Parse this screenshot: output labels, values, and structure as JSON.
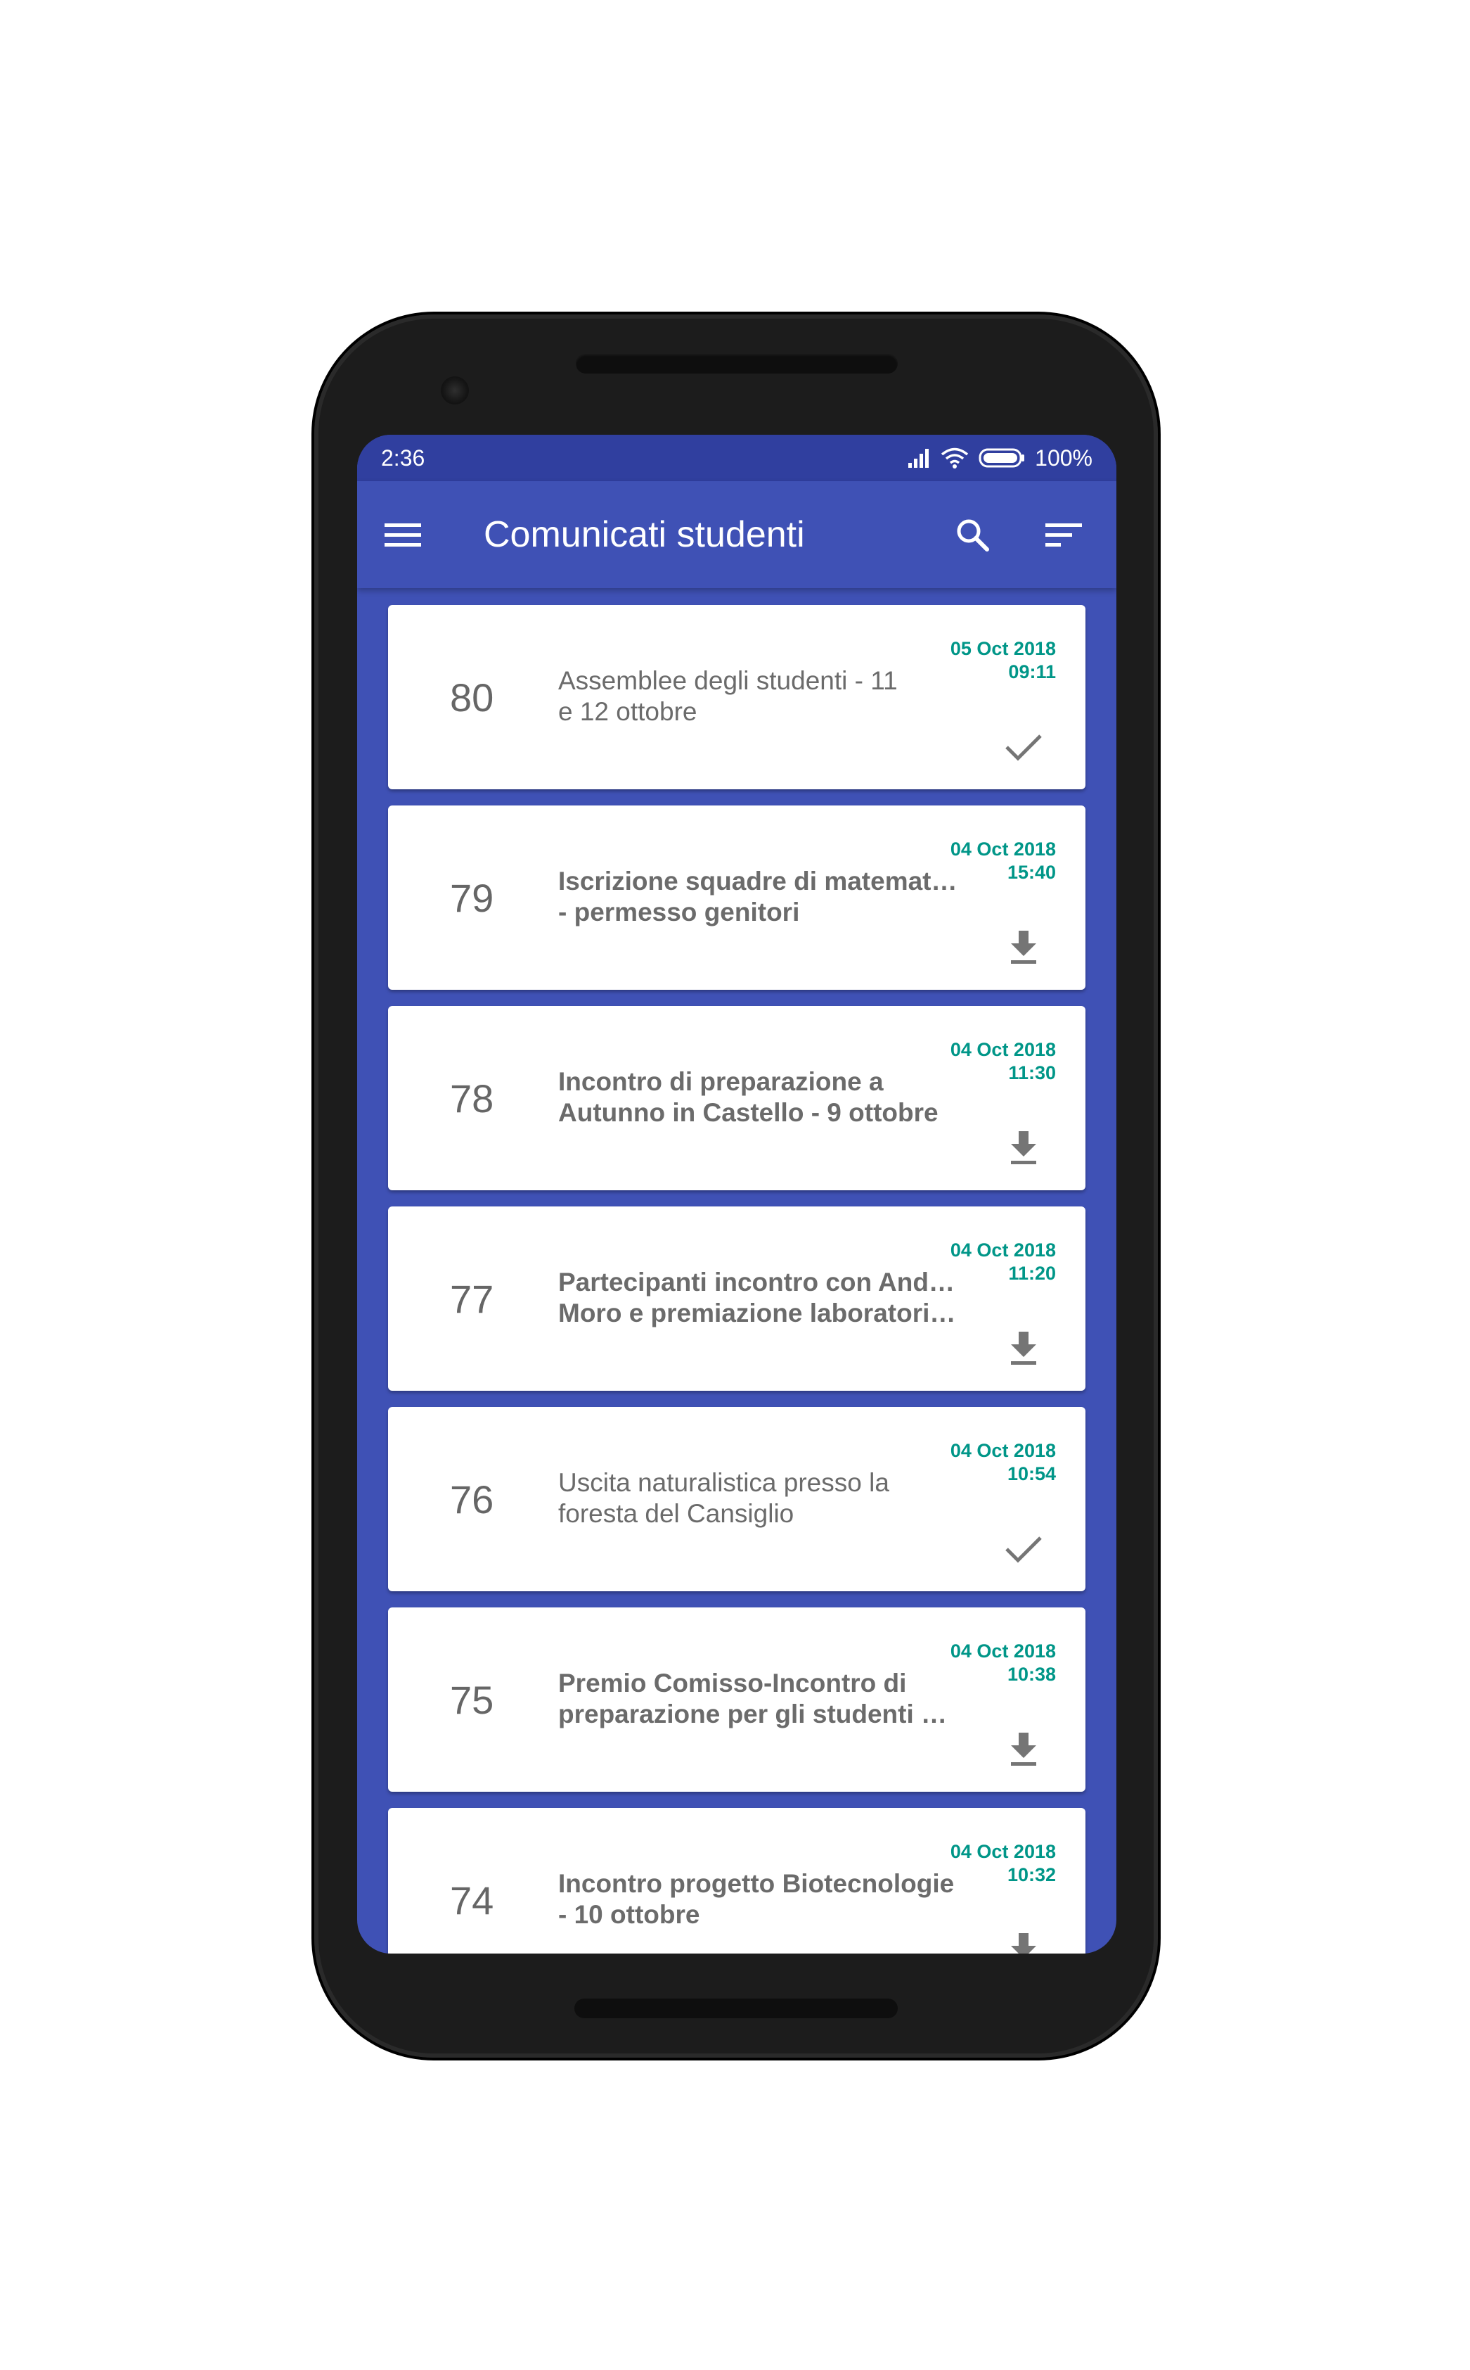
{
  "status_bar": {
    "time": "2:36",
    "battery": "100%"
  },
  "app_bar": {
    "title": "Comunicati studenti",
    "icons": [
      "menu-icon",
      "search-icon",
      "sort-icon"
    ]
  },
  "colors": {
    "primary": "#3f51b5",
    "primary_dark": "#303f9f",
    "accent_date": "#009688",
    "text_gray": "#6b6b6b"
  },
  "items": [
    {
      "number": "80",
      "line1": "Assemblee degli studenti - 11",
      "line2": "e 12 ottobre",
      "date": "05 Oct 2018",
      "time": "09:11",
      "unread": false,
      "status_icon": "check-icon"
    },
    {
      "number": "79",
      "line1": "Iscrizione squadre di matematica",
      "line2": "- permesso genitori",
      "date": "04 Oct 2018",
      "time": "15:40",
      "unread": true,
      "status_icon": "download-icon"
    },
    {
      "number": "78",
      "line1": "Incontro di preparazione a",
      "line2": "Autunno in Castello - 9 ottobre",
      "date": "04 Oct 2018",
      "time": "11:30",
      "unread": true,
      "status_icon": "download-icon"
    },
    {
      "number": "77",
      "line1": "Partecipanti incontro con Andrea",
      "line2": "Moro e premiazione laboratorio ...",
      "date": "04 Oct 2018",
      "time": "11:20",
      "unread": true,
      "status_icon": "download-icon"
    },
    {
      "number": "76",
      "line1": "Uscita naturalistica presso la",
      "line2": "foresta del Cansiglio",
      "date": "04 Oct 2018",
      "time": "10:54",
      "unread": false,
      "status_icon": "check-icon"
    },
    {
      "number": "75",
      "line1": "Premio Comisso-Incontro di",
      "line2": "preparazione per gli studenti ch...",
      "date": "04 Oct 2018",
      "time": "10:38",
      "unread": true,
      "status_icon": "download-icon"
    },
    {
      "number": "74",
      "line1": "Incontro progetto Biotecnologie",
      "line2": "- 10 ottobre",
      "date": "04 Oct 2018",
      "time": "10:32",
      "unread": true,
      "status_icon": "download-icon"
    }
  ]
}
